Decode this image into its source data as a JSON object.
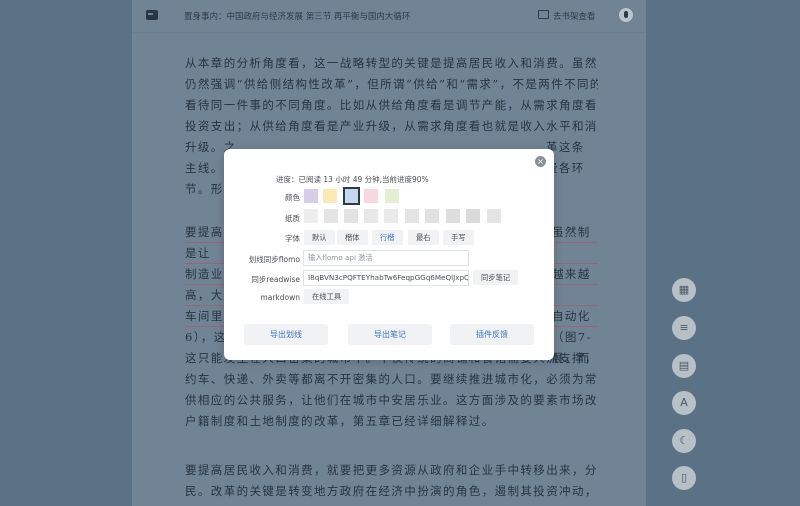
{
  "topbar": {
    "title": "置身事内：中国政府与经济发展 第三节 再平衡与国内大循环",
    "shelf_label": "去书架查看"
  },
  "reader": {
    "para1": [
      "从本章的分析角度看，这一战略转型的关键是提高居民收入和消费。虽然政府目前",
      "仍然强调“供给侧结构性改革”，但所谓“供给”和“需求”，不是两件不同的事，只是",
      "看待同一件事的不同角度。比如从供给角度看是调节产能，从需求角度看就是调整",
      "投资支出；从供给角度看是产业升级，从需求角度看也就是收入水平和消费结构的",
      "升级。之",
      "主线。法",
      "节。形成"
    ],
    "para1_tail": [
      "革这条",
      "费各环",
      ""
    ],
    "para2": [
      "要提高居",
      "是让",
      "制造业中",
      "高，大家",
      "车间里工",
      "6），这",
      "这只能发生在人口密集的城市中。不仅传统的商铺和餐馆需要人流支撑，新兴的网",
      "约车、快递、外卖等都离不开密集的人口。要继续推进城市化，必须为常住人口提",
      "供相应的公共服务，让他们在城市中安居乐业。这方面涉及的要素市场改革，包括",
      "户籍制度和土地制度的改革，第五章已经详细解释过。"
    ],
    "para2_tail": [
      "虽然制",
      "越来越",
      "越来越",
      "自动化",
      "（图7-",
      "展，而"
    ],
    "para3": [
      "要提高居民收入和消费，就要把更多资源从政府和企业手中转移出来，分配给居",
      "民。改革的关键是转变地方政府在经济中扮演的角色，遏制其投资冲动，降低其主"
    ]
  },
  "side_tools": {
    "icons": [
      "grid-icon",
      "list-icon",
      "comment-icon",
      "font-icon",
      "moon-icon",
      "phone-icon"
    ],
    "font_glyph": "A"
  },
  "modal": {
    "progress": "进度：已阅读 13 小时 49 分钟,当前进度90%",
    "color_label": "颜色",
    "colors": [
      "#d7cde6",
      "#fbeab3",
      "#c5d9ee",
      "#f8d7e1",
      "#e4efd2"
    ],
    "texture_label": "纸质",
    "font_label": "字体",
    "fonts": [
      "默认",
      "楷体",
      "行楷",
      "最右",
      "手写"
    ],
    "active_font": "行楷",
    "flomo_label": "划线同步flomo",
    "flomo_placeholder": "输入flomo api 激活",
    "readwise_label": "同步readwise",
    "readwise_value": "I8qBVN3cPQFTEYhabTw6FeqpGGq6MeQlJxpQO",
    "readwise_button": "同步笔记",
    "markdown_label": "markdown",
    "markdown_button": "在线工具",
    "export_highlights": "导出划线",
    "export_notes": "导出笔记",
    "feedback": "插件反馈",
    "accent": "#3a76c4"
  }
}
